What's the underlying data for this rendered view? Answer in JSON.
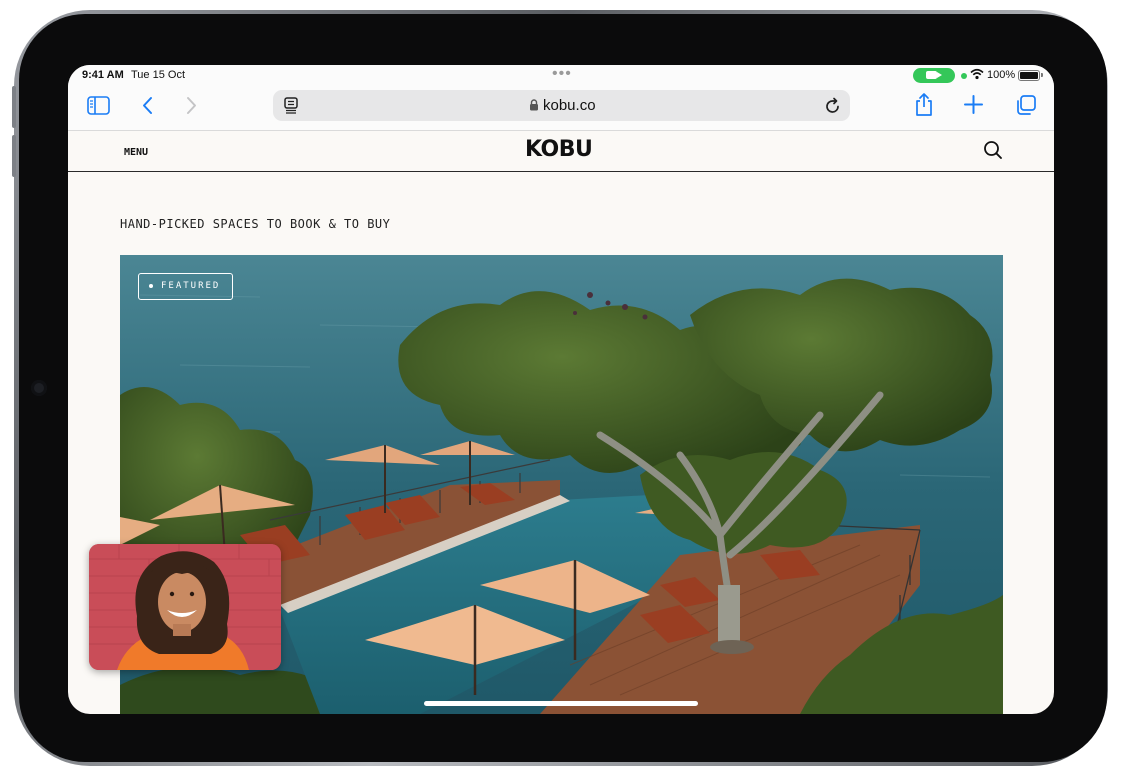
{
  "status_bar": {
    "time": "9:41 AM",
    "date": "Tue 15 Oct",
    "battery": "100%",
    "facetime_active": true
  },
  "toolbar": {
    "url": "kobu.co",
    "icons": [
      "sidebar-icon",
      "back-icon",
      "forward-icon",
      "reader-icon",
      "lock-icon",
      "reload-icon",
      "share-icon",
      "new-tab-icon",
      "tabs-icon"
    ]
  },
  "site": {
    "menu_label": "MENU",
    "logo": "KOBU",
    "tagline": "HAND-PICKED SPACES TO BOOK & TO BUY",
    "hero_badge": "FEATURED"
  },
  "colors": {
    "facetime_green": "#34c759",
    "page_bg": "#fbf9f6",
    "sea": "#2d6878",
    "umbrella": "#e3a47a",
    "deck": "#8a5236"
  }
}
